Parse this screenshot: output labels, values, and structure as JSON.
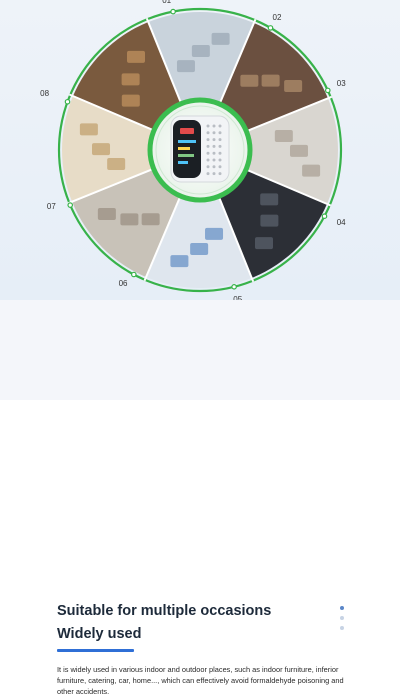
{
  "wheel_labels": [
    "01",
    "02",
    "03",
    "04",
    "05",
    "06",
    "07",
    "08"
  ],
  "scenes": [
    "office-scene",
    "kitchen-cabinet-scene",
    "kitchen-appliance-scene",
    "car-interior-scene",
    "conference-scene",
    "living-room-scene",
    "sofa-room-scene",
    "restaurant-scene"
  ],
  "colors": {
    "ring": "#38b24a",
    "accent": "#2f6fd6",
    "device_ring": "#3bbd4f"
  },
  "info": {
    "title": "Suitable for multiple occasions",
    "subtitle": "Widely used",
    "description": "It is widely used in various indoor and outdoor places, such as indoor furniture, inferior furniture, catering, car, home..., which can effectively avoid formaldehyde poisoning and other accidents."
  },
  "pager": {
    "dots": 3,
    "active": 0
  }
}
